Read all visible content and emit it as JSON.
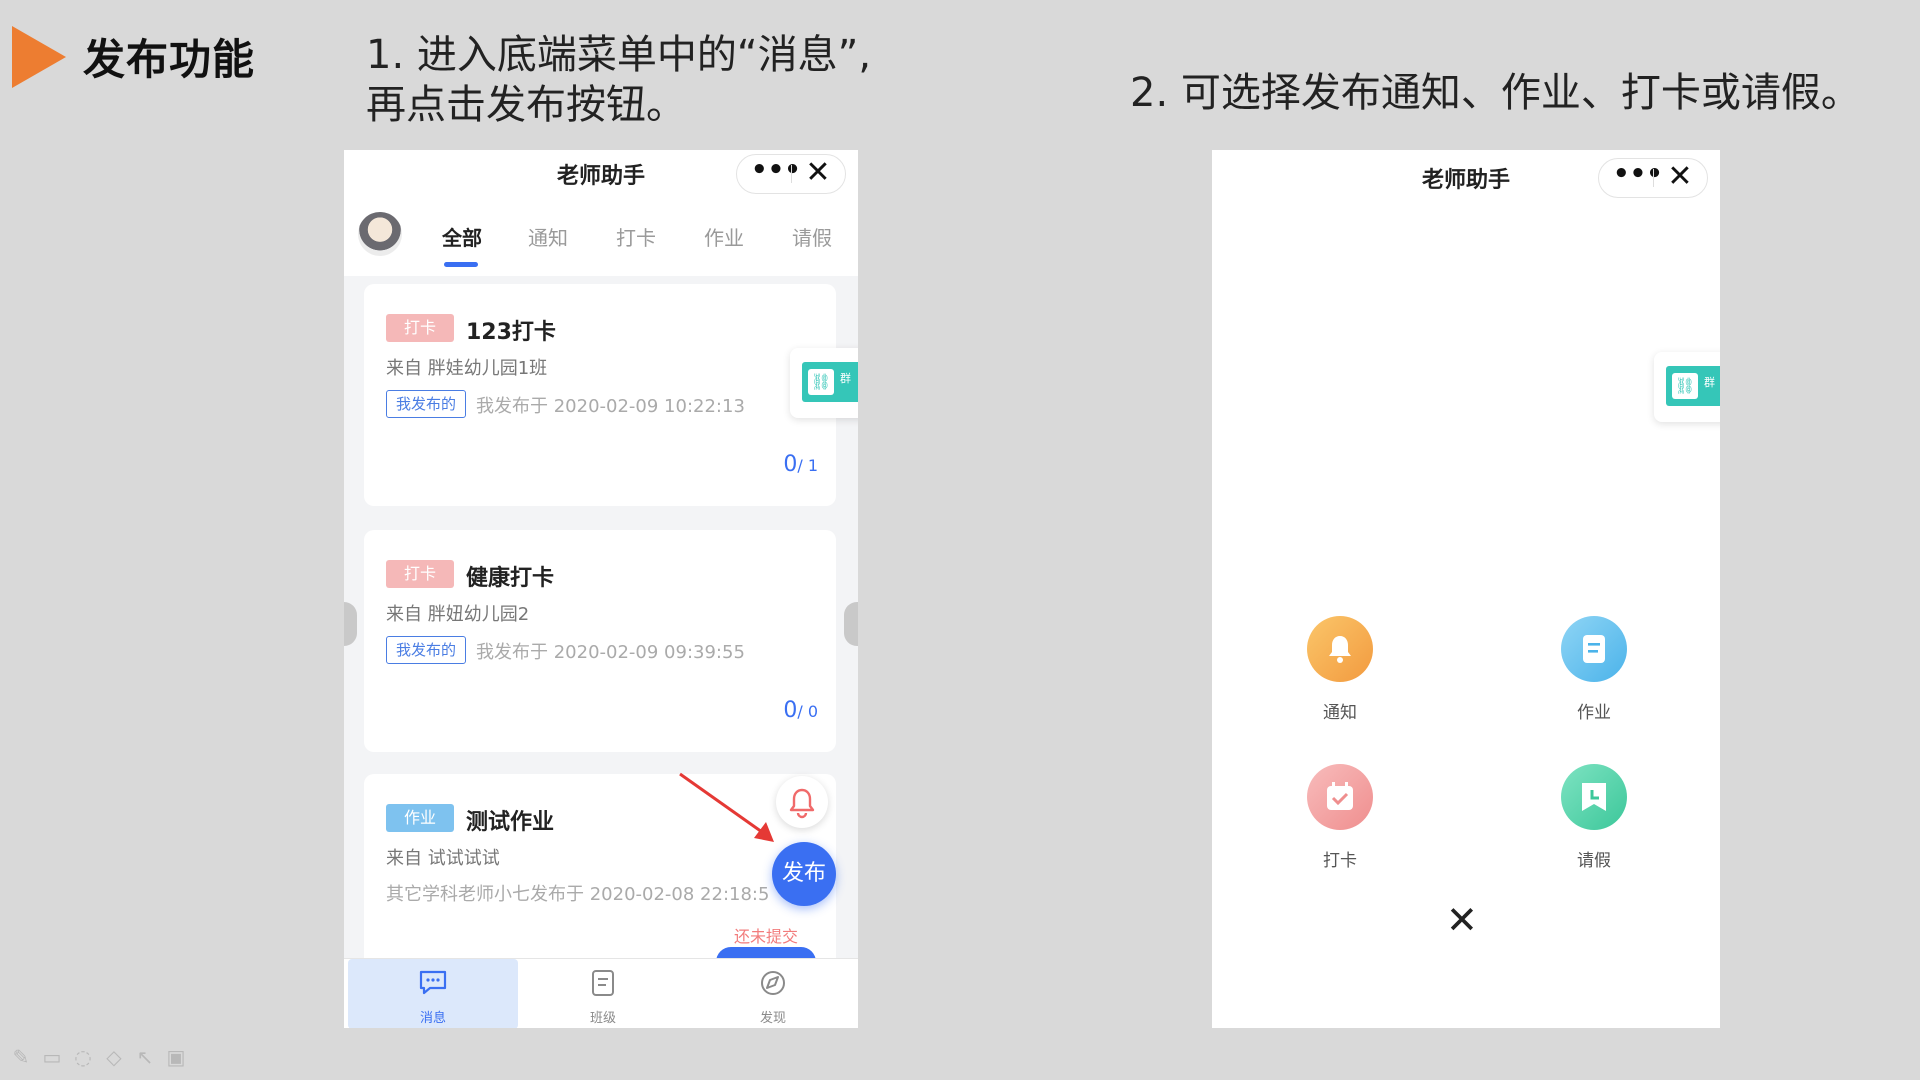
{
  "slide": {
    "title": "发布功能",
    "step1_line1": "1. 进入底端菜单中的“消息”,",
    "step1_line2": "再点击发布按钮。",
    "step2": "2. 可选择发布通知、作业、打卡或请假。"
  },
  "colors": {
    "accent": "#ed7d31",
    "primary_blue": "#3a6ff2",
    "badge_pink": "#f5b8b8",
    "badge_blue": "#7ec2ef",
    "teal": "#35c6b8",
    "arrow_red": "#e53935"
  },
  "phone1": {
    "header": {
      "title": "老师助手",
      "more_icon": "•••",
      "close_icon": "✕"
    },
    "tabs": [
      {
        "label": "全部",
        "active": true
      },
      {
        "label": "通知"
      },
      {
        "label": "打卡"
      },
      {
        "label": "作业"
      },
      {
        "label": "请假"
      }
    ],
    "cards": [
      {
        "badge": "打卡",
        "title": "123打卡",
        "from": "来自 胖娃幼儿园1班",
        "tag": "我发布的",
        "time": "我发布于 2020-02-09 10:22:13",
        "count_done": "0",
        "count_total": "/ 1"
      },
      {
        "badge": "打卡",
        "title": "健康打卡",
        "from": "来自 胖妞幼儿园2",
        "tag": "我发布的",
        "time": "我发布于 2020-02-09 09:39:55",
        "count_done": "0",
        "count_total": "/ 0"
      },
      {
        "badge": "作业",
        "title": "测试作业",
        "from": "来自 试试试试",
        "time": "其它学科老师小七发布于 2020-02-08 22:18:5"
      }
    ],
    "publish_button": "发布",
    "not_submitted": "还未提交",
    "float_link_text": "群",
    "bottom_nav": [
      {
        "label": "消息",
        "icon": "message-icon",
        "active": true
      },
      {
        "label": "班级",
        "icon": "class-icon"
      },
      {
        "label": "发现",
        "icon": "discover-icon"
      }
    ]
  },
  "phone2": {
    "header": {
      "title": "老师助手",
      "more_icon": "•••",
      "close_icon": "✕"
    },
    "menu": [
      {
        "label": "通知",
        "icon": "bell-icon"
      },
      {
        "label": "作业",
        "icon": "document-icon"
      },
      {
        "label": "打卡",
        "icon": "calendar-check-icon"
      },
      {
        "label": "请假",
        "icon": "leave-icon"
      }
    ],
    "close_icon": "✕",
    "float_link_text": "群"
  }
}
